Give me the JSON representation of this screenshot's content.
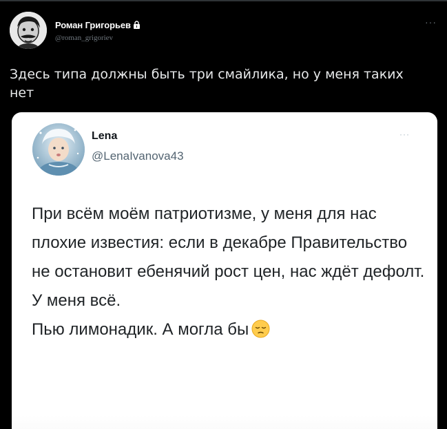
{
  "outer_tweet": {
    "author_name": "Роман Григорьев",
    "handle": "@roman_grigoriev",
    "more_label": "···",
    "text": "Здесь типа должны быть три смайлика, но у меня таких нет"
  },
  "quoted_tweet": {
    "author_name": "Lena",
    "handle": "@LenaIvanova43",
    "more_label": "···",
    "lines": [
      "При всём моём патриотизме, у меня для нас плохие известия: если в декабре Правительство не остановит ебенячий рост цен, нас ждёт дефолт.",
      "У меня всё.",
      "Пью лимонадик. А могла бы"
    ],
    "emoji": "pensive-face"
  },
  "colors": {
    "background": "#000000",
    "outer_text": "#e7e9ea",
    "muted": "#6e767d",
    "card_background": "#ffffff",
    "card_text": "#1f2326"
  }
}
